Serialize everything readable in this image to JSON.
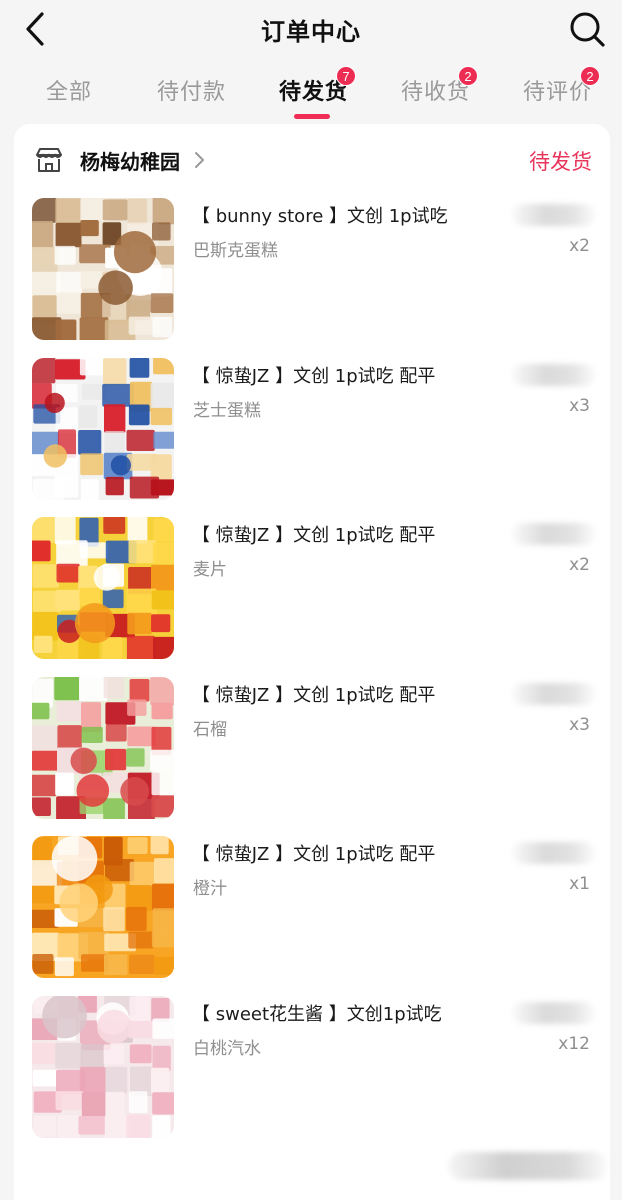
{
  "header": {
    "title": "订单中心",
    "back_icon": "chevron-left-icon",
    "search_icon": "search-icon"
  },
  "tabs": [
    {
      "label": "全部",
      "badge": null,
      "active": false
    },
    {
      "label": "待付款",
      "badge": null,
      "active": false
    },
    {
      "label": "待发货",
      "badge": "7",
      "active": true
    },
    {
      "label": "待收货",
      "badge": "2",
      "active": false
    },
    {
      "label": "待评价",
      "badge": "2",
      "active": false
    }
  ],
  "order": {
    "shop_name": "杨梅幼稚园",
    "shop_icon": "store-icon",
    "status": "待发货",
    "items": [
      {
        "title": "【 bunny store 】文创 1p试吃",
        "spec": "巴斯克蛋糕",
        "qty": "x2"
      },
      {
        "title": "【 惊蛰JZ 】文创 1p试吃 配平",
        "spec": "芝士蛋糕",
        "qty": "x3"
      },
      {
        "title": "【 惊蛰JZ 】文创 1p试吃 配平",
        "spec": "麦片",
        "qty": "x2"
      },
      {
        "title": "【 惊蛰JZ 】文创 1p试吃 配平",
        "spec": "石榴",
        "qty": "x3"
      },
      {
        "title": "【 惊蛰JZ 】文创 1p试吃 配平",
        "spec": "橙汁",
        "qty": "x1"
      },
      {
        "title": "【 sweet花生酱 】文创1p试吃",
        "spec": "白桃汽水",
        "qty": "x12"
      }
    ]
  },
  "colors": {
    "accent": "#ef2d57",
    "badge": "#ec2c52",
    "status": "#e8345a",
    "background": "#f5f5f5",
    "card": "#ffffff",
    "muted_text": "#8f8f8f"
  }
}
